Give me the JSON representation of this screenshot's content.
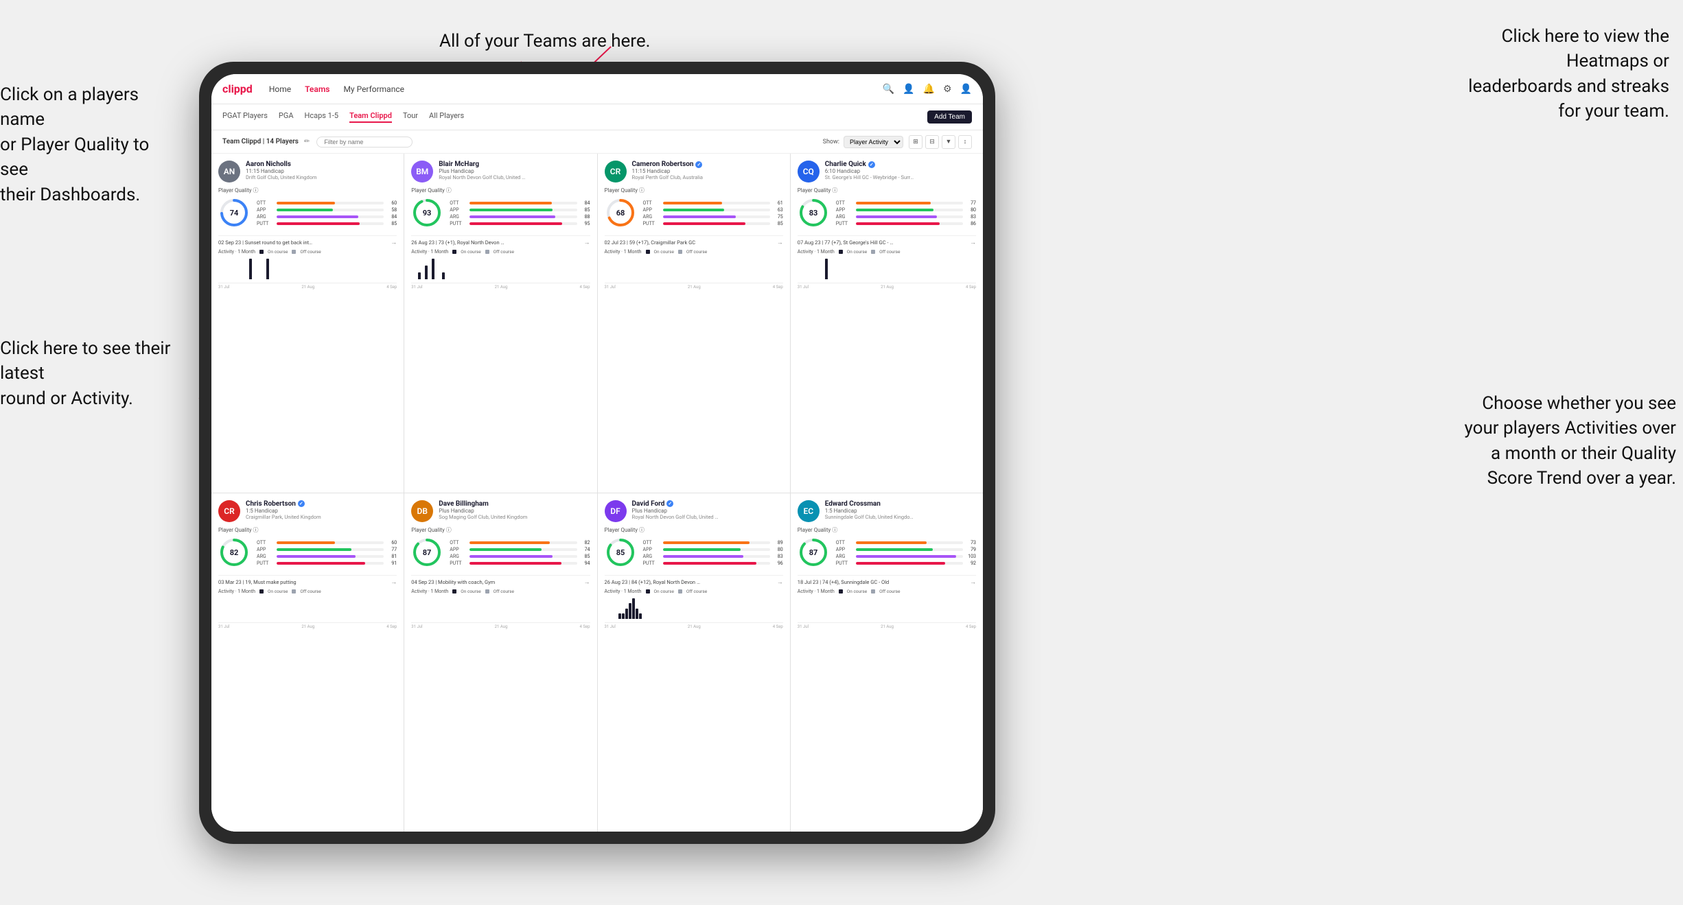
{
  "page": {
    "background": "#f0f0f0"
  },
  "annotations": {
    "teams_note": "All of your Teams are here.",
    "heatmaps_note": "Click here to view the\nHeatmaps or leaderboards\nand streaks for your team.",
    "players_name_note": "Click on a players name\nor Player Quality to see\ntheir Dashboards.",
    "latest_round_note": "Click here to see their latest\nround or Activity.",
    "activities_note": "Choose whether you see\nyour players Activities over\na month or their Quality\nScore Trend over a year."
  },
  "nav": {
    "logo": "clippd",
    "items": [
      "Home",
      "Teams",
      "My Performance"
    ],
    "active": "Teams"
  },
  "sub_nav": {
    "items": [
      "PGAT Players",
      "PGA",
      "Hcaps 1-5",
      "Team Clippd",
      "Tour",
      "All Players"
    ],
    "active": "Team Clippd",
    "add_team_label": "Add Team"
  },
  "team_header": {
    "label": "Team Clippd | 14 Players",
    "search_placeholder": "Filter by name",
    "show_label": "Show:",
    "show_value": "Player Activity"
  },
  "players": [
    {
      "name": "Aaron Nicholls",
      "handicap": "11:15 Handicap",
      "club": "Drift Golf Club, United Kingdom",
      "quality": 74,
      "ott": 60,
      "app": 58,
      "arg": 84,
      "putt": 85,
      "latest_round": "02 Sep 23 | Sunset round to get back into it, F...",
      "avatar_color": "#6b7280",
      "avatar_initials": "AN",
      "verified": false,
      "chart_data": [
        0,
        0,
        0,
        0,
        0,
        0,
        0,
        0,
        0,
        1,
        0,
        0,
        0,
        0,
        1,
        0
      ]
    },
    {
      "name": "Blair McHarg",
      "handicap": "Plus Handicap",
      "club": "Royal North Devon Golf Club, United Kin...",
      "quality": 93,
      "ott": 84,
      "app": 85,
      "arg": 88,
      "putt": 95,
      "latest_round": "26 Aug 23 | 73 (+1), Royal North Devon GC",
      "avatar_color": "#8b5cf6",
      "avatar_initials": "BM",
      "verified": false,
      "chart_data": [
        0,
        0,
        1,
        0,
        2,
        0,
        3,
        0,
        0,
        1,
        0,
        0,
        0,
        0,
        0,
        0
      ]
    },
    {
      "name": "Cameron Robertson",
      "handicap": "11:15 Handicap",
      "club": "Royal Perth Golf Club, Australia",
      "quality": 68,
      "ott": 61,
      "app": 63,
      "arg": 75,
      "putt": 85,
      "latest_round": "02 Jul 23 | 59 (+17), Craigmillar Park GC",
      "avatar_color": "#059669",
      "avatar_initials": "CR",
      "verified": true,
      "chart_data": [
        0,
        0,
        0,
        0,
        0,
        0,
        0,
        0,
        0,
        0,
        0,
        0,
        0,
        0,
        0,
        0
      ]
    },
    {
      "name": "Charlie Quick",
      "handicap": "6:10 Handicap",
      "club": "St. George's Hill GC - Weybridge - Surrey...",
      "quality": 83,
      "ott": 77,
      "app": 80,
      "arg": 83,
      "putt": 86,
      "latest_round": "07 Aug 23 | 77 (+7), St George's Hill GC - Red...",
      "avatar_color": "#2563eb",
      "avatar_initials": "CQ",
      "verified": true,
      "chart_data": [
        0,
        0,
        0,
        0,
        0,
        0,
        0,
        0,
        1,
        0,
        0,
        0,
        0,
        0,
        0,
        0
      ]
    },
    {
      "name": "Chris Robertson",
      "handicap": "1:5 Handicap",
      "club": "Craigmillar Park, United Kingdom",
      "quality": 82,
      "ott": 60,
      "app": 77,
      "arg": 81,
      "putt": 91,
      "latest_round": "03 Mar 23 | 19, Must make putting",
      "avatar_color": "#dc2626",
      "avatar_initials": "CR",
      "verified": true,
      "chart_data": [
        0,
        0,
        0,
        0,
        0,
        0,
        0,
        0,
        0,
        0,
        0,
        0,
        0,
        0,
        0,
        0
      ]
    },
    {
      "name": "Dave Billingham",
      "handicap": "Plus Handicap",
      "club": "Sog Maging Golf Club, United Kingdom",
      "quality": 87,
      "ott": 82,
      "app": 74,
      "arg": 85,
      "putt": 94,
      "latest_round": "04 Sep 23 | Mobility with coach, Gym",
      "avatar_color": "#d97706",
      "avatar_initials": "DB",
      "verified": false,
      "chart_data": [
        0,
        0,
        0,
        0,
        0,
        0,
        0,
        0,
        0,
        0,
        0,
        0,
        0,
        0,
        0,
        0
      ]
    },
    {
      "name": "David Ford",
      "handicap": "Plus Handicap",
      "club": "Royal North Devon Golf Club, United Kil...",
      "quality": 85,
      "ott": 89,
      "app": 80,
      "arg": 83,
      "putt": 96,
      "latest_round": "26 Aug 23 | 84 (+12), Royal North Devon GC",
      "avatar_color": "#7c3aed",
      "avatar_initials": "DF",
      "verified": true,
      "chart_data": [
        0,
        0,
        0,
        0,
        1,
        1,
        2,
        3,
        4,
        2,
        1,
        0,
        0,
        0,
        0,
        0
      ]
    },
    {
      "name": "Edward Crossman",
      "handicap": "1:5 Handicap",
      "club": "Sunningdale Golf Club, United Kingdom",
      "quality": 87,
      "ott": 73,
      "app": 79,
      "arg": 103,
      "putt": 92,
      "latest_round": "18 Jul 23 | 74 (+4), Sunningdale GC - Old",
      "avatar_color": "#0891b2",
      "avatar_initials": "EC",
      "verified": false,
      "chart_data": [
        0,
        0,
        0,
        0,
        0,
        0,
        0,
        0,
        0,
        0,
        0,
        0,
        0,
        0,
        0,
        0
      ]
    }
  ],
  "activity": {
    "period_label": "Activity · 1 Month",
    "on_course_label": "On course",
    "off_course_label": "Off course"
  },
  "x_labels": [
    "31 Jul",
    "21 Aug",
    "4 Sep"
  ]
}
